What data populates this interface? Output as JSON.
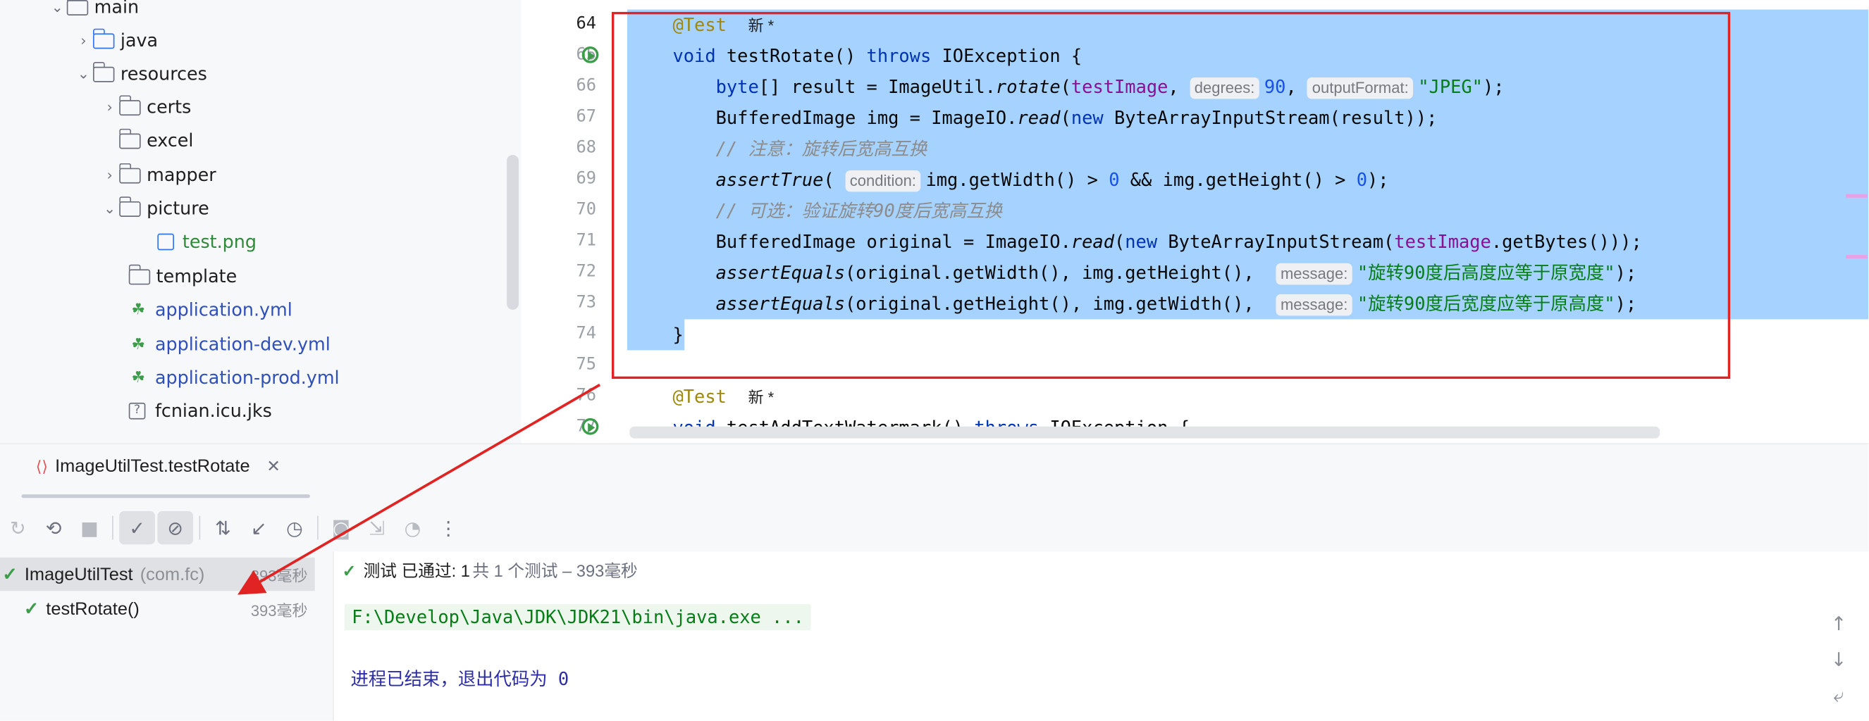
{
  "tree": {
    "items": [
      {
        "label": "main"
      },
      {
        "label": "java"
      },
      {
        "label": "resources"
      },
      {
        "label": "certs"
      },
      {
        "label": "excel"
      },
      {
        "label": "mapper"
      },
      {
        "label": "picture"
      },
      {
        "label": "test.png"
      },
      {
        "label": "template"
      },
      {
        "label": "application.yml"
      },
      {
        "label": "application-dev.yml"
      },
      {
        "label": "application-prod.yml"
      },
      {
        "label": "fcnian.icu.jks"
      }
    ]
  },
  "editor": {
    "line_numbers": [
      "64",
      "65",
      "66",
      "67",
      "68",
      "69",
      "70",
      "71",
      "72",
      "73",
      "74",
      "75",
      "76",
      "77"
    ],
    "new_tag": "新 *",
    "hints": {
      "degrees": "degrees:",
      "output_format": "outputFormat:",
      "condition": "condition:",
      "message": "message:"
    },
    "comment1": "// 注意：旋转后宽高互换",
    "comment2": "// 可选：验证旋转90度后宽高互换",
    "msg1": "\"旋转90度后高度应等于原宽度\"",
    "msg2": "\"旋转90度后宽度应等于原高度\""
  },
  "run": {
    "tab_label": "ImageUtilTest.testRotate",
    "status": "测试 已通过: 1",
    "status_sub": "共 1 个测试 – 393毫秒",
    "results": [
      {
        "name": "ImageUtilTest",
        "pkg": "(com.fc)",
        "duration": "393毫秒"
      },
      {
        "name": "testRotate()",
        "duration": "393毫秒"
      }
    ],
    "console_cmd": "F:\\Develop\\Java\\JDK\\JDK21\\bin\\java.exe ...",
    "console_exit": "进程已结束，退出代码为 0"
  },
  "colors": {
    "selection": "#a6d2ff",
    "highlight_box": "#e02424",
    "pass_green": "#3d9c4a"
  }
}
